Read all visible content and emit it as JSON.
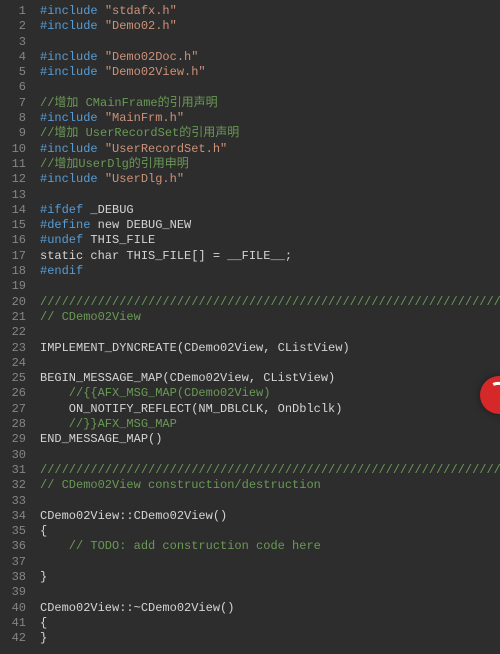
{
  "editor": {
    "lines": [
      {
        "n": 1,
        "raw": "#include \"stdafx.h\""
      },
      {
        "n": 2,
        "raw": "#include \"Demo02.h\""
      },
      {
        "n": 3,
        "raw": ""
      },
      {
        "n": 4,
        "raw": "#include \"Demo02Doc.h\""
      },
      {
        "n": 5,
        "raw": "#include \"Demo02View.h\""
      },
      {
        "n": 6,
        "raw": ""
      },
      {
        "n": 7,
        "raw": "//增加 CMainFrame的引用声明"
      },
      {
        "n": 8,
        "raw": "#include \"MainFrm.h\""
      },
      {
        "n": 9,
        "raw": "//增加 UserRecordSet的引用声明"
      },
      {
        "n": 10,
        "raw": "#include \"UserRecordSet.h\""
      },
      {
        "n": 11,
        "raw": "//增加UserDlg的引用申明"
      },
      {
        "n": 12,
        "raw": "#include \"UserDlg.h\""
      },
      {
        "n": 13,
        "raw": ""
      },
      {
        "n": 14,
        "raw": "#ifdef _DEBUG"
      },
      {
        "n": 15,
        "raw": "#define new DEBUG_NEW"
      },
      {
        "n": 16,
        "raw": "#undef THIS_FILE"
      },
      {
        "n": 17,
        "raw": "static char THIS_FILE[] = __FILE__;"
      },
      {
        "n": 18,
        "raw": "#endif"
      },
      {
        "n": 19,
        "raw": ""
      },
      {
        "n": 20,
        "raw": "/////////////////////////////////////////////////////////////////////"
      },
      {
        "n": 21,
        "raw": "// CDemo02View"
      },
      {
        "n": 22,
        "raw": ""
      },
      {
        "n": 23,
        "raw": "IMPLEMENT_DYNCREATE(CDemo02View, CListView)"
      },
      {
        "n": 24,
        "raw": ""
      },
      {
        "n": 25,
        "raw": "BEGIN_MESSAGE_MAP(CDemo02View, CListView)"
      },
      {
        "n": 26,
        "raw": "    //{{AFX_MSG_MAP(CDemo02View)"
      },
      {
        "n": 27,
        "raw": "    ON_NOTIFY_REFLECT(NM_DBLCLK, OnDblclk)"
      },
      {
        "n": 28,
        "raw": "    //}}AFX_MSG_MAP"
      },
      {
        "n": 29,
        "raw": "END_MESSAGE_MAP()"
      },
      {
        "n": 30,
        "raw": ""
      },
      {
        "n": 31,
        "raw": "/////////////////////////////////////////////////////////////////////"
      },
      {
        "n": 32,
        "raw": "// CDemo02View construction/destruction"
      },
      {
        "n": 33,
        "raw": ""
      },
      {
        "n": 34,
        "raw": "CDemo02View::CDemo02View()"
      },
      {
        "n": 35,
        "raw": "{"
      },
      {
        "n": 36,
        "raw": "    // TODO: add construction code here"
      },
      {
        "n": 37,
        "raw": ""
      },
      {
        "n": 38,
        "raw": "}"
      },
      {
        "n": 39,
        "raw": ""
      },
      {
        "n": 40,
        "raw": "CDemo02View::~CDemo02View()"
      },
      {
        "n": 41,
        "raw": "{"
      },
      {
        "n": 42,
        "raw": "}"
      }
    ]
  },
  "badge": {
    "name": "watermark-badge"
  }
}
